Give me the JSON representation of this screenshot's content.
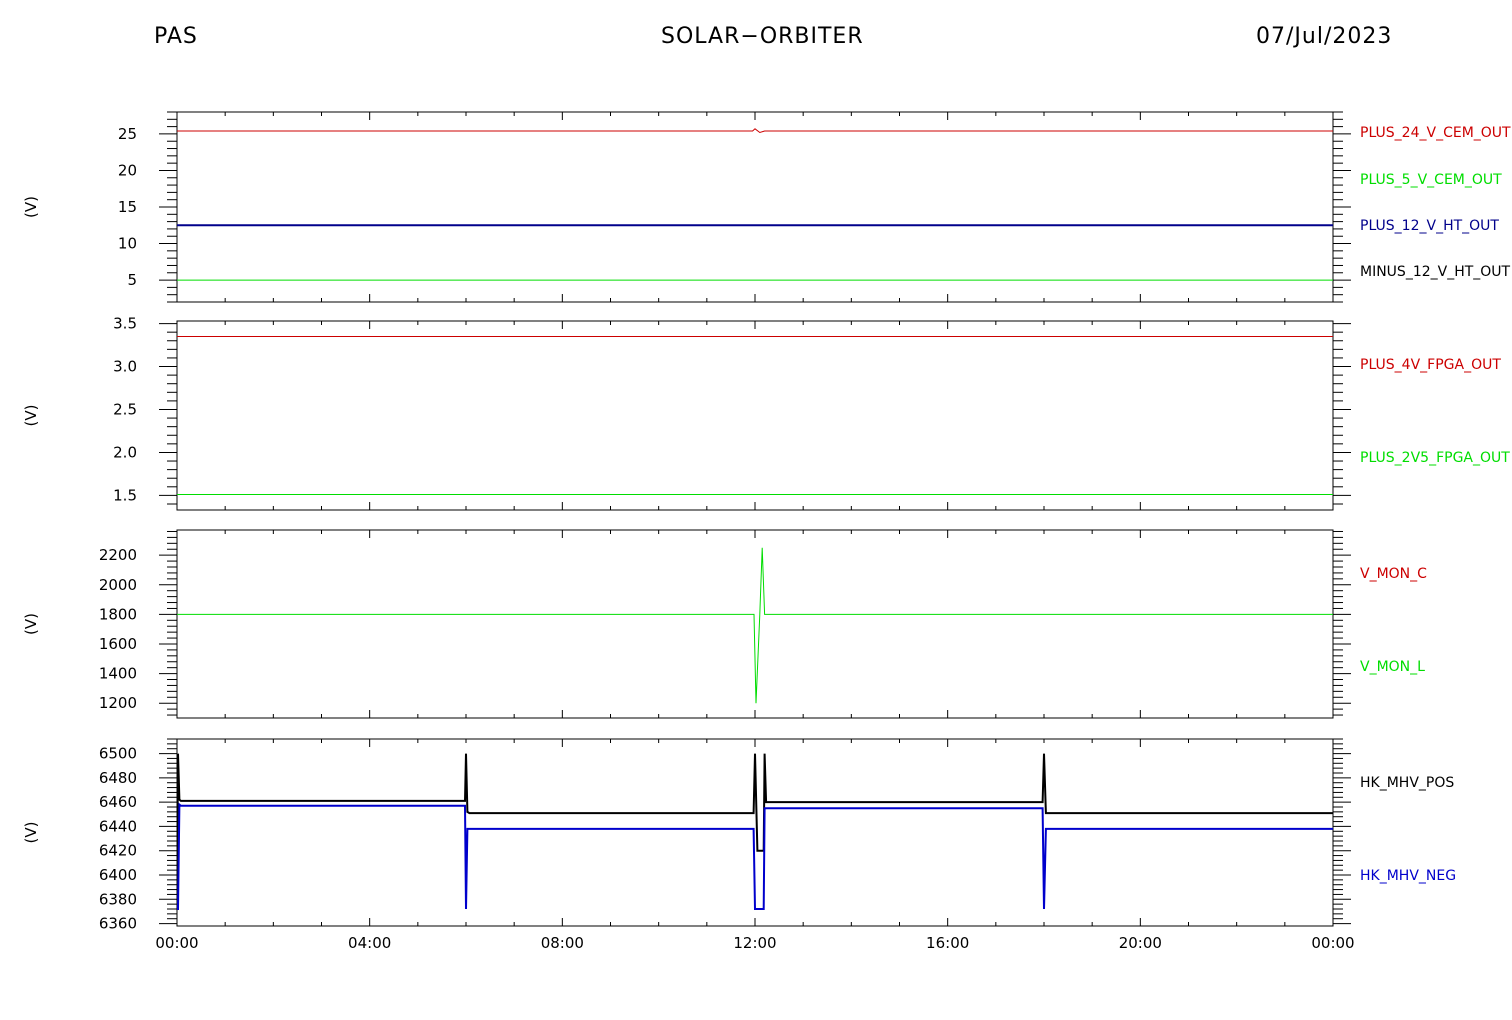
{
  "header": {
    "left": "PAS",
    "center": "SOLAR−ORBITER",
    "right": "07/Jul/2023"
  },
  "chart_data": [
    {
      "type": "line",
      "ylabel": "(V)",
      "ylim": [
        2,
        28
      ],
      "yticks": [
        5,
        10,
        15,
        20,
        25
      ],
      "xlim": [
        0,
        24
      ],
      "series": [
        {
          "name": "PLUS_24_V_CEM_OUT",
          "color": "#cc0000",
          "x": [
            0,
            11.95,
            12.0,
            12.1,
            12.2,
            24
          ],
          "values": [
            25.4,
            25.4,
            25.7,
            25.2,
            25.4,
            25.4
          ]
        },
        {
          "name": "PLUS_5_V_CEM_OUT",
          "color": "#00dd00",
          "x": [
            0,
            24
          ],
          "values": [
            5.0,
            5.0
          ]
        },
        {
          "name": "PLUS_12_V_HT_OUT",
          "color": "#00008b",
          "x": [
            0,
            24
          ],
          "values": [
            12.5,
            12.5
          ]
        },
        {
          "name": "MINUS_12_V_HT_OUT",
          "color": "#000000",
          "x": [],
          "values": []
        }
      ]
    },
    {
      "type": "line",
      "ylabel": "(V)",
      "ylim": [
        1.33,
        3.53
      ],
      "yticks": [
        1.5,
        2.0,
        2.5,
        3.0,
        3.5
      ],
      "xlim": [
        0,
        24
      ],
      "series": [
        {
          "name": "PLUS_4V_FPGA_OUT",
          "color": "#cc0000",
          "x": [
            0,
            24
          ],
          "values": [
            3.35,
            3.35
          ]
        },
        {
          "name": "PLUS_2V5_FPGA_OUT",
          "color": "#00dd00",
          "x": [
            0,
            24
          ],
          "values": [
            1.51,
            1.51
          ]
        }
      ]
    },
    {
      "type": "line",
      "ylabel": "(V)",
      "ylim": [
        1100,
        2370
      ],
      "yticks": [
        1200,
        1400,
        1600,
        1800,
        2000,
        2200
      ],
      "xlim": [
        0,
        24
      ],
      "series": [
        {
          "name": "V_MON_C",
          "color": "#cc0000",
          "x": [],
          "values": []
        },
        {
          "name": "V_MON_L",
          "color": "#00dd00",
          "x": [
            0,
            11.98,
            12.02,
            12.1,
            12.15,
            12.2,
            24
          ],
          "values": [
            1800,
            1800,
            1200,
            1800,
            2250,
            1800,
            1800
          ]
        }
      ]
    },
    {
      "type": "line",
      "ylabel": "(V)",
      "ylim": [
        6358,
        6512
      ],
      "yticks": [
        6360,
        6380,
        6400,
        6420,
        6440,
        6460,
        6480,
        6500
      ],
      "xlim": [
        0,
        24
      ],
      "series": [
        {
          "name": "HK_MHV_POS",
          "color": "#000000",
          "x": [
            0,
            0.02,
            0.05,
            0.08,
            5.98,
            6.0,
            6.03,
            6.07,
            11.97,
            12.0,
            12.05,
            12.18,
            12.2,
            12.23,
            17.97,
            18.0,
            18.04,
            24
          ],
          "values": [
            6380,
            6500,
            6462,
            6461,
            6461,
            6500,
            6452,
            6451,
            6451,
            6500,
            6420,
            6420,
            6500,
            6460,
            6460,
            6500,
            6451,
            6451
          ]
        },
        {
          "name": "HK_MHV_NEG",
          "color": "#0000cc",
          "x": [
            0,
            0.02,
            0.05,
            0.08,
            5.98,
            6.0,
            6.03,
            6.07,
            11.97,
            12.0,
            12.05,
            12.18,
            12.2,
            12.23,
            17.97,
            18.0,
            18.04,
            24
          ],
          "values": [
            6372,
            6372,
            6458,
            6457,
            6457,
            6372,
            6438,
            6438,
            6438,
            6372,
            6372,
            6372,
            6455,
            6455,
            6455,
            6372,
            6438,
            6438
          ]
        }
      ]
    }
  ],
  "xaxis": {
    "ticks": [
      0,
      4,
      8,
      12,
      16,
      20,
      24
    ],
    "tick_labels": [
      "00:00",
      "04:00",
      "08:00",
      "12:00",
      "16:00",
      "20:00",
      "00:00"
    ]
  }
}
